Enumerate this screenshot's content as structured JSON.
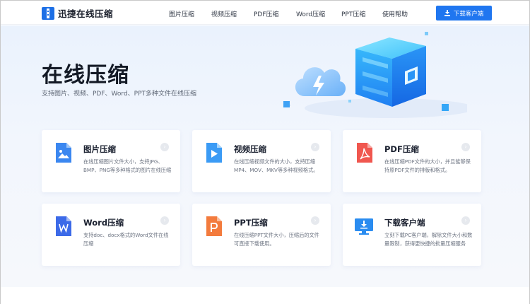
{
  "header": {
    "logo_text": "迅捷在线压缩",
    "nav": [
      {
        "label": "图片压缩"
      },
      {
        "label": "视频压缩"
      },
      {
        "label": "PDF压缩"
      },
      {
        "label": "Word压缩"
      },
      {
        "label": "PPT压缩"
      },
      {
        "label": "使用帮助"
      }
    ],
    "download_button": "下载客户端"
  },
  "hero": {
    "title": "在线压缩",
    "subtitle": "支持图片、视频、PDF、Word、PPT多种文件在线压缩"
  },
  "cards": [
    {
      "title": "图片压缩",
      "desc": "在线压缩图片文件大小，支持JPG、BMP、PNG等多种格式的图片在线压缩",
      "icon": "image-file-icon",
      "color": "#3b87f0"
    },
    {
      "title": "视频压缩",
      "desc": "在线压缩视频文件的大小，支持压缩MP4、MOV、MKV等多种视频格式。",
      "icon": "video-file-icon",
      "color": "#3b9bf5"
    },
    {
      "title": "PDF压缩",
      "desc": "在线压缩PDF文件的大小，并且能够保持原PDF文件的排版和格式。",
      "icon": "pdf-file-icon",
      "color": "#f0574f"
    },
    {
      "title": "Word压缩",
      "desc": "支持doc、docx格式的Word文件在线压缩",
      "icon": "word-file-icon",
      "color": "#3c6ae8"
    },
    {
      "title": "PPT压缩",
      "desc": "在线压缩PPT文件大小，压缩后的文件可直接下载使用。",
      "icon": "ppt-file-icon",
      "color": "#f37b3d"
    },
    {
      "title": "下载客户端",
      "desc": "立刻下载PC客户端，解除文件大小和数量限制，获得更快捷的批量压缩服务",
      "icon": "monitor-download-icon",
      "color": "#2a8cf0"
    }
  ],
  "colors": {
    "accent": "#1f76f0",
    "hero_bg": "#eaf2fd",
    "title": "#141a26"
  }
}
